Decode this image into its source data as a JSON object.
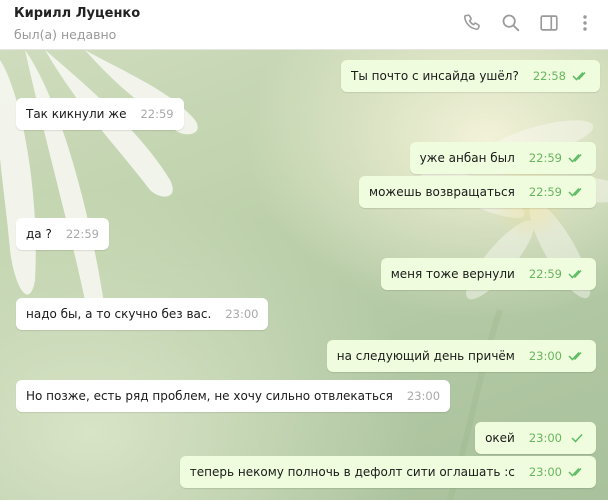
{
  "header": {
    "name": "Кирилл Луценко",
    "status": "был(а) недавно",
    "icons": [
      "phone-icon",
      "search-icon",
      "sidebar-icon",
      "more-icon"
    ]
  },
  "colors": {
    "incoming_bubble": "#ffffff",
    "outgoing_bubble": "#effdde",
    "read_check": "#5dbb63"
  },
  "messages": [
    {
      "text": "Ты почто с инсайда ушёл?",
      "time": "22:58",
      "dir": "out",
      "status": "read"
    },
    {
      "text": "Так кикнули же",
      "time": "22:59",
      "dir": "in"
    },
    {
      "text": "уже анбан был",
      "time": "22:59",
      "dir": "out",
      "status": "read"
    },
    {
      "text": "можешь возвращаться",
      "time": "22:59",
      "dir": "out",
      "status": "read"
    },
    {
      "text": "да ?",
      "time": "22:59",
      "dir": "in"
    },
    {
      "text": "меня тоже вернули",
      "time": "22:59",
      "dir": "out",
      "status": "read"
    },
    {
      "text": "надо бы, а то скучно без вас.",
      "time": "23:00",
      "dir": "in"
    },
    {
      "text": "на следующий день причём",
      "time": "23:00",
      "dir": "out",
      "status": "read"
    },
    {
      "text": "Но позже, есть ряд проблем, не хочу сильно отвлекаться",
      "time": "23:00",
      "dir": "in"
    },
    {
      "text": "окей",
      "time": "23:00",
      "dir": "out",
      "status": "sent"
    },
    {
      "text": "теперь некому полночь в дефолт сити оглашать :с",
      "time": "23:00",
      "dir": "out",
      "status": "read"
    }
  ]
}
